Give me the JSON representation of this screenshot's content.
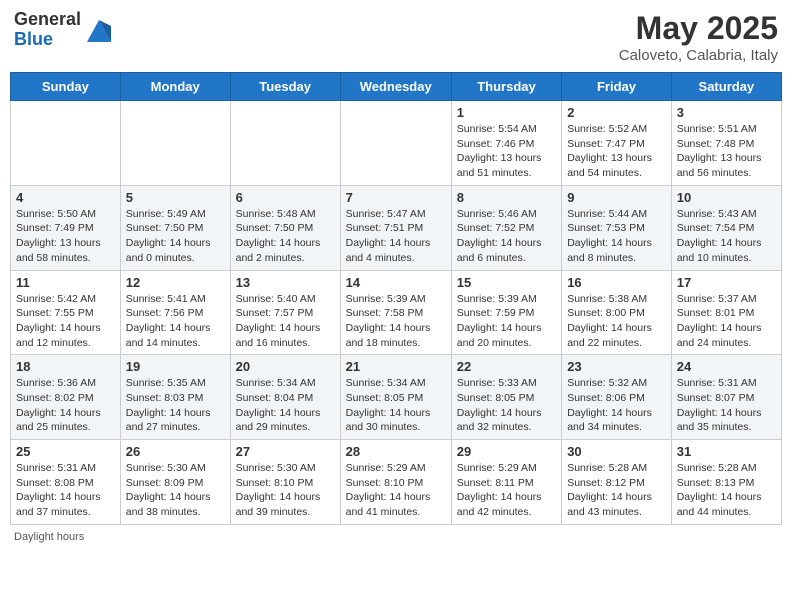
{
  "header": {
    "logo_general": "General",
    "logo_blue": "Blue",
    "month_year": "May 2025",
    "location": "Caloveto, Calabria, Italy"
  },
  "weekdays": [
    "Sunday",
    "Monday",
    "Tuesday",
    "Wednesday",
    "Thursday",
    "Friday",
    "Saturday"
  ],
  "weeks": [
    [
      {
        "day": "",
        "info": ""
      },
      {
        "day": "",
        "info": ""
      },
      {
        "day": "",
        "info": ""
      },
      {
        "day": "",
        "info": ""
      },
      {
        "day": "1",
        "info": "Sunrise: 5:54 AM\nSunset: 7:46 PM\nDaylight: 13 hours\nand 51 minutes."
      },
      {
        "day": "2",
        "info": "Sunrise: 5:52 AM\nSunset: 7:47 PM\nDaylight: 13 hours\nand 54 minutes."
      },
      {
        "day": "3",
        "info": "Sunrise: 5:51 AM\nSunset: 7:48 PM\nDaylight: 13 hours\nand 56 minutes."
      }
    ],
    [
      {
        "day": "4",
        "info": "Sunrise: 5:50 AM\nSunset: 7:49 PM\nDaylight: 13 hours\nand 58 minutes."
      },
      {
        "day": "5",
        "info": "Sunrise: 5:49 AM\nSunset: 7:50 PM\nDaylight: 14 hours\nand 0 minutes."
      },
      {
        "day": "6",
        "info": "Sunrise: 5:48 AM\nSunset: 7:50 PM\nDaylight: 14 hours\nand 2 minutes."
      },
      {
        "day": "7",
        "info": "Sunrise: 5:47 AM\nSunset: 7:51 PM\nDaylight: 14 hours\nand 4 minutes."
      },
      {
        "day": "8",
        "info": "Sunrise: 5:46 AM\nSunset: 7:52 PM\nDaylight: 14 hours\nand 6 minutes."
      },
      {
        "day": "9",
        "info": "Sunrise: 5:44 AM\nSunset: 7:53 PM\nDaylight: 14 hours\nand 8 minutes."
      },
      {
        "day": "10",
        "info": "Sunrise: 5:43 AM\nSunset: 7:54 PM\nDaylight: 14 hours\nand 10 minutes."
      }
    ],
    [
      {
        "day": "11",
        "info": "Sunrise: 5:42 AM\nSunset: 7:55 PM\nDaylight: 14 hours\nand 12 minutes."
      },
      {
        "day": "12",
        "info": "Sunrise: 5:41 AM\nSunset: 7:56 PM\nDaylight: 14 hours\nand 14 minutes."
      },
      {
        "day": "13",
        "info": "Sunrise: 5:40 AM\nSunset: 7:57 PM\nDaylight: 14 hours\nand 16 minutes."
      },
      {
        "day": "14",
        "info": "Sunrise: 5:39 AM\nSunset: 7:58 PM\nDaylight: 14 hours\nand 18 minutes."
      },
      {
        "day": "15",
        "info": "Sunrise: 5:39 AM\nSunset: 7:59 PM\nDaylight: 14 hours\nand 20 minutes."
      },
      {
        "day": "16",
        "info": "Sunrise: 5:38 AM\nSunset: 8:00 PM\nDaylight: 14 hours\nand 22 minutes."
      },
      {
        "day": "17",
        "info": "Sunrise: 5:37 AM\nSunset: 8:01 PM\nDaylight: 14 hours\nand 24 minutes."
      }
    ],
    [
      {
        "day": "18",
        "info": "Sunrise: 5:36 AM\nSunset: 8:02 PM\nDaylight: 14 hours\nand 25 minutes."
      },
      {
        "day": "19",
        "info": "Sunrise: 5:35 AM\nSunset: 8:03 PM\nDaylight: 14 hours\nand 27 minutes."
      },
      {
        "day": "20",
        "info": "Sunrise: 5:34 AM\nSunset: 8:04 PM\nDaylight: 14 hours\nand 29 minutes."
      },
      {
        "day": "21",
        "info": "Sunrise: 5:34 AM\nSunset: 8:05 PM\nDaylight: 14 hours\nand 30 minutes."
      },
      {
        "day": "22",
        "info": "Sunrise: 5:33 AM\nSunset: 8:05 PM\nDaylight: 14 hours\nand 32 minutes."
      },
      {
        "day": "23",
        "info": "Sunrise: 5:32 AM\nSunset: 8:06 PM\nDaylight: 14 hours\nand 34 minutes."
      },
      {
        "day": "24",
        "info": "Sunrise: 5:31 AM\nSunset: 8:07 PM\nDaylight: 14 hours\nand 35 minutes."
      }
    ],
    [
      {
        "day": "25",
        "info": "Sunrise: 5:31 AM\nSunset: 8:08 PM\nDaylight: 14 hours\nand 37 minutes."
      },
      {
        "day": "26",
        "info": "Sunrise: 5:30 AM\nSunset: 8:09 PM\nDaylight: 14 hours\nand 38 minutes."
      },
      {
        "day": "27",
        "info": "Sunrise: 5:30 AM\nSunset: 8:10 PM\nDaylight: 14 hours\nand 39 minutes."
      },
      {
        "day": "28",
        "info": "Sunrise: 5:29 AM\nSunset: 8:10 PM\nDaylight: 14 hours\nand 41 minutes."
      },
      {
        "day": "29",
        "info": "Sunrise: 5:29 AM\nSunset: 8:11 PM\nDaylight: 14 hours\nand 42 minutes."
      },
      {
        "day": "30",
        "info": "Sunrise: 5:28 AM\nSunset: 8:12 PM\nDaylight: 14 hours\nand 43 minutes."
      },
      {
        "day": "31",
        "info": "Sunrise: 5:28 AM\nSunset: 8:13 PM\nDaylight: 14 hours\nand 44 minutes."
      }
    ]
  ],
  "footer": {
    "daylight_hours": "Daylight hours"
  }
}
